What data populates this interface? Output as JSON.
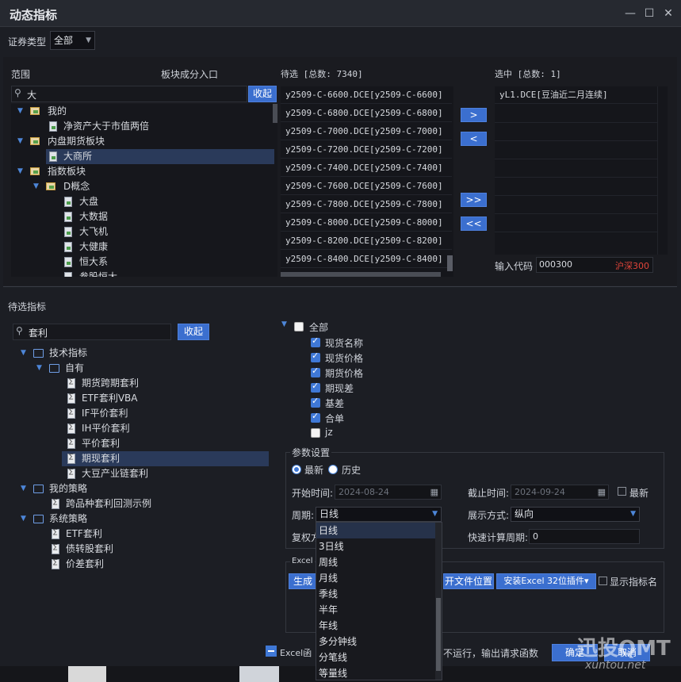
{
  "window": {
    "title": "动态指标"
  },
  "security_type": {
    "label": "证券类型",
    "value": "全部"
  },
  "scope": {
    "label": "范围",
    "entry_label": "板块成分入口",
    "search_value": "大",
    "collapse_btn": "收起",
    "tree": {
      "mine": "我的",
      "mine_child": "净资产大于市值两倍",
      "futures": "内盘期货板块",
      "futures_child": "大商所",
      "index": "指数板块",
      "dconcept": "D概念",
      "items": [
        "大盘",
        "大数据",
        "大飞机",
        "大健康",
        "恒大系",
        "参股恒大"
      ]
    }
  },
  "candidates": {
    "header": "待选 [总数: 7340]",
    "rows": [
      "y2509-C-6600.DCE[y2509-C-6600]",
      "y2509-C-6800.DCE[y2509-C-6800]",
      "y2509-C-7000.DCE[y2509-C-7000]",
      "y2509-C-7200.DCE[y2509-C-7200]",
      "y2509-C-7400.DCE[y2509-C-7400]",
      "y2509-C-7600.DCE[y2509-C-7600]",
      "y2509-C-7800.DCE[y2509-C-7800]",
      "y2509-C-8000.DCE[y2509-C-8000]",
      "y2509-C-8200.DCE[y2509-C-8200]",
      "y2509-C-8400.DCE[y2509-C-8400]"
    ]
  },
  "transfer": {
    "add": ">",
    "remove": "<",
    "add_all": ">>",
    "remove_all": "<<"
  },
  "selected": {
    "header": "选中 [总数: 1]",
    "rows": [
      "yL1.DCE[豆油近二月连续]"
    ],
    "code_label": "输入代码",
    "code_value": "000300",
    "code_name": "沪深300"
  },
  "pending": {
    "label": "待选指标",
    "search_value": "套利",
    "collapse_btn": "收起",
    "tree": {
      "tech": "技术指标",
      "own": "自有",
      "own_items": [
        "期货跨期套利",
        "ETF套利VBA",
        "IF平价套利",
        "IH平价套利",
        "平价套利",
        "期现套利",
        "大豆产业链套利"
      ],
      "strategy": "我的策略",
      "strategy_items": [
        "跨品种套利回测示例"
      ],
      "system": "系统策略",
      "system_items": [
        "ETF套利",
        "债转股套利",
        "价差套利"
      ]
    }
  },
  "fields": {
    "all": "全部",
    "items": [
      {
        "label": "现货名称",
        "checked": true
      },
      {
        "label": "现货价格",
        "checked": true
      },
      {
        "label": "期货价格",
        "checked": true
      },
      {
        "label": "期现差",
        "checked": true
      },
      {
        "label": "基差",
        "checked": true
      },
      {
        "label": "合单",
        "checked": true
      },
      {
        "label": "jz",
        "checked": false
      }
    ]
  },
  "params": {
    "title": "参数设置",
    "latest": "最新",
    "history": "历史",
    "start_label": "开始时间:",
    "start_value": "2024-08-24",
    "end_label": "截止时间:",
    "end_value": "2024-09-24",
    "end_latest": "最新",
    "period_label": "周期:",
    "period_value": "日线",
    "display_label": "展示方式:",
    "display_value": "纵向",
    "fuquan_label": "复权方",
    "quick_label": "快速计算周期:",
    "quick_value": "0",
    "period_options": [
      "日线",
      "3日线",
      "周线",
      "月线",
      "季线",
      "半年",
      "年线",
      "多分钟线",
      "分笔线",
      "等量线"
    ]
  },
  "excel": {
    "label": "Excel",
    "gen_btn": "生成函",
    "open_btn": "开文件位置",
    "install_btn": "安装Excel 32位插件",
    "show_name": "显示指标名",
    "bottom_left": "Excel函",
    "bottom_mid": "不运行，输出请求函数",
    "ok": "确定",
    "cancel": "取消"
  },
  "watermark": {
    "brand": "迅投QMT",
    "url": "xuntou.net"
  }
}
